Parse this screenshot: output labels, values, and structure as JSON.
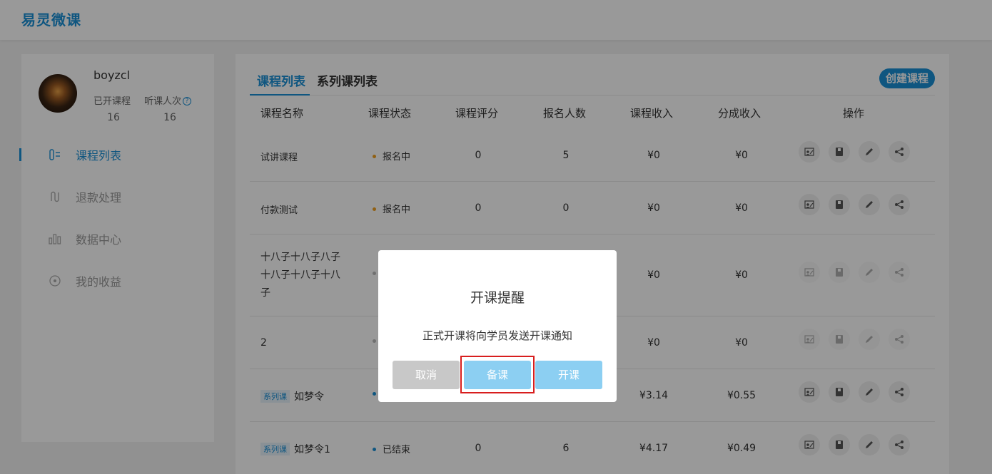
{
  "app": {
    "brand": "易灵微课"
  },
  "profile": {
    "username": "boyzcl",
    "stats": [
      {
        "label": "已开课程",
        "value": "16"
      },
      {
        "label": "听课人次",
        "value": "16"
      }
    ],
    "help_icon": "?"
  },
  "nav": [
    {
      "label": "课程列表",
      "icon": "course-list-icon",
      "active": true
    },
    {
      "label": "退款处理",
      "icon": "refund-icon",
      "active": false
    },
    {
      "label": "数据中心",
      "icon": "data-chart-icon",
      "active": false
    },
    {
      "label": "我的收益",
      "icon": "earnings-icon",
      "active": false
    }
  ],
  "tabs": [
    {
      "label": "课程列表",
      "active": true
    },
    {
      "label": "系列课列表",
      "active": false
    }
  ],
  "create_button": "创建课程",
  "table": {
    "headers": [
      "课程名称",
      "课程状态",
      "课程评分",
      "报名人数",
      "课程收入",
      "分成收入",
      "操作"
    ],
    "rows": [
      {
        "series_tag": "",
        "name": "试讲课程",
        "status": "报名中",
        "status_color": "#f0a020",
        "rating": "0",
        "signups": "5",
        "income": "¥0",
        "share": "¥0"
      },
      {
        "series_tag": "",
        "name": "付款测试",
        "status": "报名中",
        "status_color": "#f0a020",
        "rating": "0",
        "signups": "0",
        "income": "¥0",
        "share": "¥0"
      },
      {
        "series_tag": "",
        "name": "十八子十八子八子十八子十八子十八子",
        "status": "",
        "status_color": "#bbbbbb",
        "rating": "",
        "signups": "",
        "income": "¥0",
        "share": "¥0"
      },
      {
        "series_tag": "",
        "name": "2",
        "status": "",
        "status_color": "#bbbbbb",
        "rating": "",
        "signups": "",
        "income": "¥0",
        "share": "¥0"
      },
      {
        "series_tag": "系列课",
        "name": "如梦令",
        "status": "",
        "status_color": "#1a8fd6",
        "rating": "",
        "signups": "",
        "income": "¥3.14",
        "share": "¥0.55"
      },
      {
        "series_tag": "系列课",
        "name": "如梦令1",
        "status": "已结束",
        "status_color": "#1a8fd6",
        "rating": "0",
        "signups": "6",
        "income": "¥4.17",
        "share": "¥0.49"
      }
    ]
  },
  "modal": {
    "title": "开课提醒",
    "message": "正式开课将向学员发送开课通知",
    "buttons": {
      "cancel": "取消",
      "prepare": "备课",
      "start": "开课"
    }
  }
}
